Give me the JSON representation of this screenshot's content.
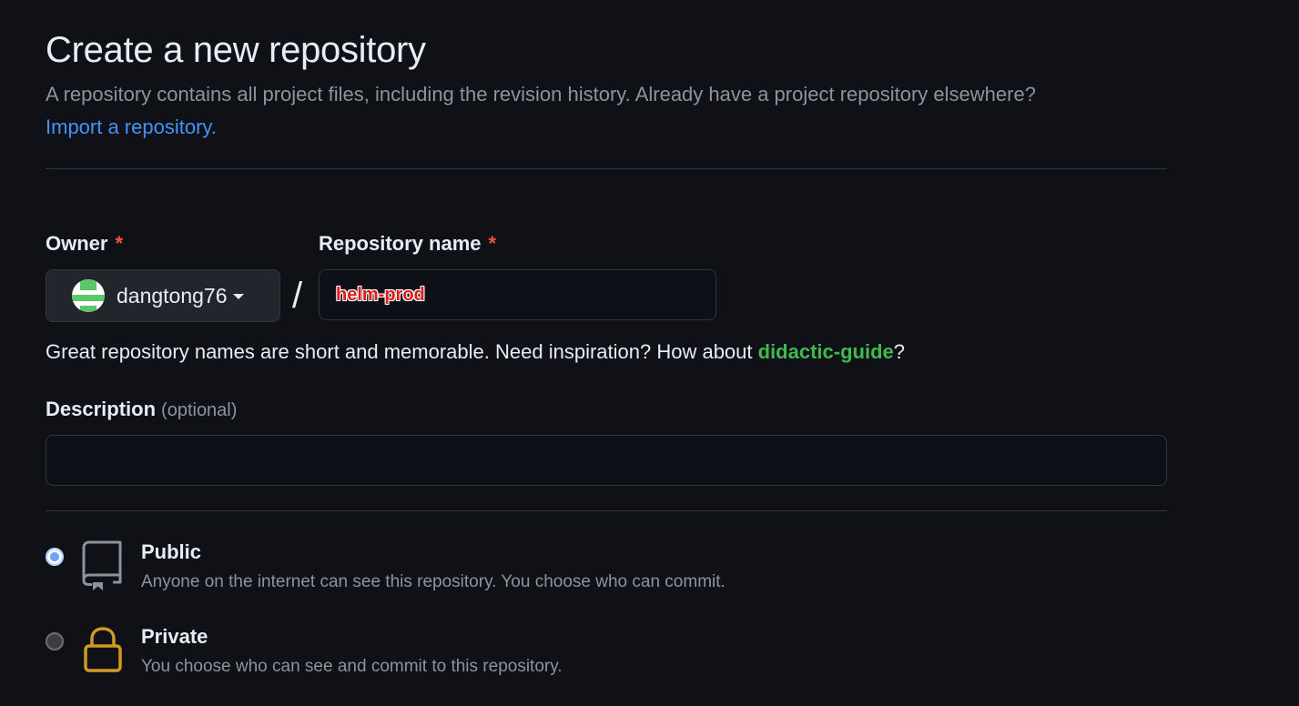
{
  "header": {
    "title": "Create a new repository",
    "subtitle": "A repository contains all project files, including the revision history. Already have a project repository elsewhere?",
    "import_link": "Import a repository."
  },
  "owner": {
    "label": "Owner",
    "required_mark": "*",
    "selected": "dangtong76",
    "avatar_color": "#5cc66a"
  },
  "slash": "/",
  "repository": {
    "label": "Repository name",
    "required_mark": "*",
    "value": "helm-prod"
  },
  "hint": {
    "prefix": "Great repository names are short and memorable. Need inspiration? How about ",
    "suggestion": "didactic-guide",
    "suffix": "?"
  },
  "description": {
    "label": "Description",
    "optional": "(optional)",
    "value": ""
  },
  "visibility": {
    "selected": "public",
    "options": [
      {
        "key": "public",
        "title": "Public",
        "desc": "Anyone on the internet can see this repository. You choose who can commit.",
        "icon": "repo-icon"
      },
      {
        "key": "private",
        "title": "Private",
        "desc": "You choose who can see and commit to this repository.",
        "icon": "lock-icon"
      }
    ]
  },
  "colors": {
    "background": "#0f1116",
    "link": "#4493f8",
    "suggestion": "#3fb950",
    "required": "#f85149",
    "lock": "#d29922"
  }
}
